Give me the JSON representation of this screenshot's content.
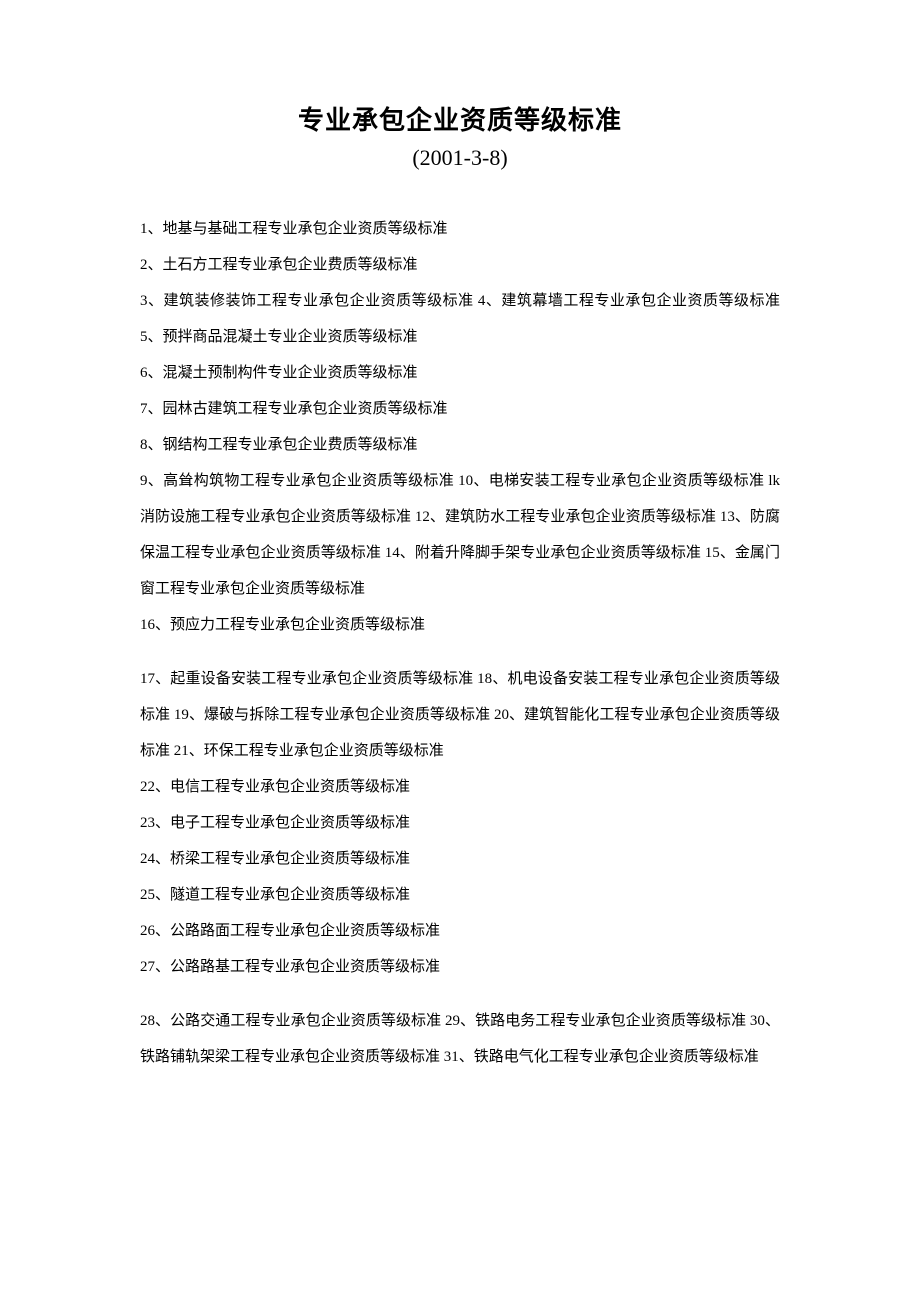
{
  "title": "专业承包企业资质等级标准",
  "subtitle": "(2001-3-8)",
  "paragraphs": [
    {
      "text": "1、地基与基础工程专业承包企业资质等级标准",
      "gap": false
    },
    {
      "text": "2、土石方工程专业承包企业费质等级标准",
      "gap": false
    },
    {
      "text": "3、建筑装修装饰工程专业承包企业资质等级标准 4、建筑幕墙工程专业承包企业资质等级标准 5、预拌商品混凝土专业企业资质等级标准",
      "gap": false
    },
    {
      "text": "6、混凝土预制构件专业企业资质等级标准",
      "gap": false
    },
    {
      "text": "7、园林古建筑工程专业承包企业资质等级标准",
      "gap": false
    },
    {
      "text": "8、钢结构工程专业承包企业费质等级标准",
      "gap": false
    },
    {
      "text": "9、高耸构筑物工程专业承包企业资质等级标准 10、电梯安装工程专业承包企业资质等级标准 lk 消防设施工程专业承包企业资质等级标准 12、建筑防水工程专业承包企业资质等级标准 13、防腐保温工程专业承包企业资质等级标准 14、附着升降脚手架专业承包企业资质等级标准 15、金属门窗工程专业承包企业资质等级标准",
      "gap": false
    },
    {
      "text": "16、预应力工程专业承包企业资质等级标准",
      "gap": false
    },
    {
      "text": "17、起重设备安装工程专业承包企业资质等级标准 18、机电设备安装工程专业承包企业资质等级标准 19、爆破与拆除工程专业承包企业资质等级标准 20、建筑智能化工程专业承包企业资质等级标准 21、环保工程专业承包企业资质等级标准",
      "gap": true
    },
    {
      "text": "22、电信工程专业承包企业资质等级标准",
      "gap": false
    },
    {
      "text": "23、电子工程专业承包企业资质等级标准",
      "gap": false
    },
    {
      "text": "24、桥梁工程专业承包企业资质等级标准",
      "gap": false
    },
    {
      "text": "25、隧道工程专业承包企业资质等级标准",
      "gap": false
    },
    {
      "text": "26、公路路面工程专业承包企业资质等级标准",
      "gap": false
    },
    {
      "text": "27、公路路基工程专业承包企业资质等级标准",
      "gap": false
    },
    {
      "text": "28、公路交通工程专业承包企业资质等级标准 29、铁路电务工程专业承包企业资质等级标准 30、铁路铺轨架梁工程专业承包企业资质等级标准 31、铁路电气化工程专业承包企业资质等级标准",
      "gap": true
    }
  ]
}
